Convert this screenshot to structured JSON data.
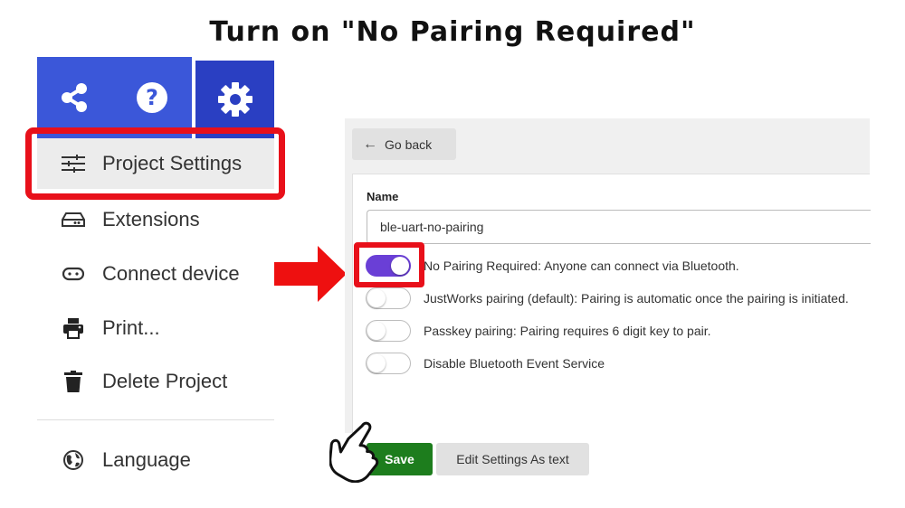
{
  "instruction": "Turn on \"No Pairing Required\"",
  "toolbar": {
    "buttons": [
      {
        "icon": "share-icon"
      },
      {
        "icon": "help-icon"
      },
      {
        "icon": "gear-icon"
      }
    ]
  },
  "menu": {
    "items": [
      {
        "label": "Project Settings",
        "icon": "sliders-icon"
      },
      {
        "label": "Extensions",
        "icon": "drive-icon"
      },
      {
        "label": "Connect device",
        "icon": "usb-icon"
      },
      {
        "label": "Print...",
        "icon": "printer-icon"
      },
      {
        "label": "Delete Project",
        "icon": "trash-icon"
      },
      {
        "label": "Language",
        "icon": "globe-icon"
      }
    ]
  },
  "settings": {
    "go_back_label": "Go back",
    "name_label": "Name",
    "name_value": "ble-uart-no-pairing",
    "options": [
      {
        "label": "No Pairing Required: Anyone can connect via Bluetooth.",
        "on": true
      },
      {
        "label": "JustWorks pairing (default): Pairing is automatic once the pairing is initiated.",
        "on": false
      },
      {
        "label": "Passkey pairing: Pairing requires 6 digit key to pair.",
        "on": false
      },
      {
        "label": "Disable Bluetooth Event Service",
        "on": false
      }
    ],
    "save_label": "Save",
    "edit_label": "Edit Settings As text"
  },
  "colors": {
    "toolbar_blue": "#3b57d9",
    "toolbar_active": "#2a3fc2",
    "highlight_red": "#e8101a",
    "toggle_on": "#6a3fd6",
    "save_green": "#1d7d1d"
  }
}
